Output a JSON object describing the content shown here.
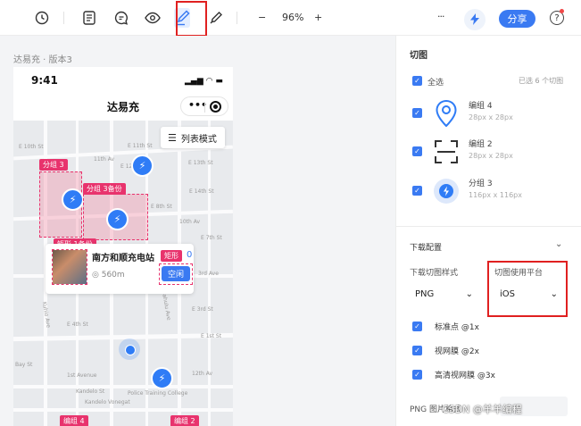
{
  "toolbar": {
    "zoom": "96%",
    "share_label": "分享",
    "help_label": "?",
    "minus_label": "−",
    "plus_label": "+",
    "more_label": "···"
  },
  "canvas": {
    "frame_caption": "达易充 · 版本3",
    "phone": {
      "time": "9:41",
      "status_icons": "▂▄▆ ◠ ▬",
      "title": "达易充",
      "capsule_more": "•••",
      "list_mode_label": "列表模式",
      "streets": [
        "E 10th St",
        "E 11th St",
        "E 13th St",
        "E 14th St",
        "E 12th St",
        "11th Av",
        "E 8th St",
        "E 7th St",
        "10th Av",
        "3rd Ave",
        "E 4th St",
        "E 3rd St",
        "E 1st St",
        "12th Av",
        "1st Avenue",
        "Kuhio Ave",
        "Kapahulu Ave",
        "Bay St",
        "Kandelo St",
        "Police Training College",
        "Kandelo Vonegat"
      ],
      "slices": [
        {
          "tag": "分组 3"
        },
        {
          "tag": "分组 3备份"
        },
        {
          "tag": "矩形 1备份"
        },
        {
          "tag": "矩形"
        },
        {
          "tag": "编组 4"
        },
        {
          "tag": "编组 2"
        }
      ],
      "card": {
        "name": "南方和顺充电站",
        "distance": "560m",
        "status": "空闲",
        "number": "0"
      }
    }
  },
  "panel": {
    "title": "切图",
    "select_all": "全选",
    "selected_count": "已选 6 个切图",
    "slices": [
      {
        "name": "编组 4",
        "size": "28px x 28px"
      },
      {
        "name": "编组 2",
        "size": "28px x 28px"
      },
      {
        "name": "分组 3",
        "size": "116px x 116px"
      }
    ],
    "download": {
      "title": "下载配置",
      "style_label": "下载切图样式",
      "style_value": "PNG",
      "platform_label": "切图使用平台",
      "platform_value": "iOS",
      "scales": [
        "标准点 @1x",
        "视网膜 @2x",
        "高清视网膜 @3x"
      ],
      "png_label": "PNG 图片格式"
    }
  },
  "watermark": "CSDN @羊羊编程",
  "colors": {
    "accent": "#3a7af2",
    "slice_pink": "#e8336d",
    "highlight_red": "#e02020"
  }
}
